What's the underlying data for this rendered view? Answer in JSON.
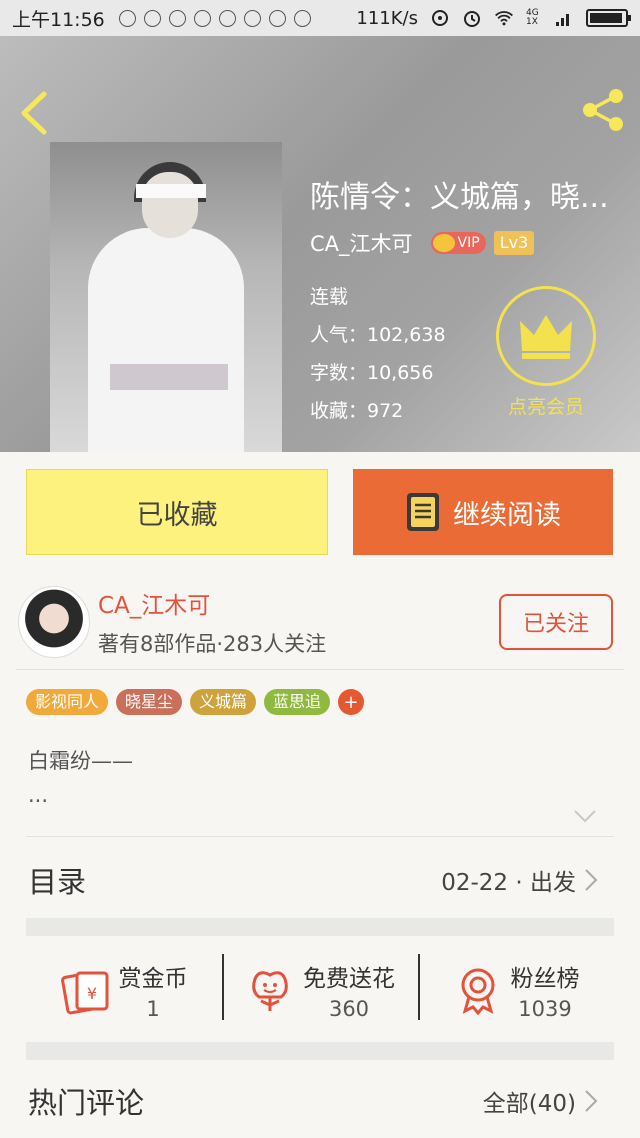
{
  "status_bar": {
    "time": "上午11:56",
    "net_speed": "111K/s",
    "network_type": "4G 1X"
  },
  "book": {
    "title": "陈情令：义城篇，晓...",
    "author": "CA_江木可",
    "vip_label": "VIP",
    "level": "Lv3",
    "status": "连载",
    "popularity": "人气：102,638",
    "word_count": "字数：10,656",
    "collections": "收藏：972"
  },
  "member": {
    "label": "点亮会员"
  },
  "actions": {
    "collected_label": "已收藏",
    "continue_label": "继续阅读"
  },
  "author_card": {
    "name": "CA_江木可",
    "meta": "著有8部作品·283人关注",
    "follow_label": "已关注"
  },
  "tags": [
    {
      "label": "影视同人",
      "color": "#f0a93a"
    },
    {
      "label": "晓星尘",
      "color": "#c96f5a"
    },
    {
      "label": "义城篇",
      "color": "#cfa33b"
    },
    {
      "label": "蓝思追",
      "color": "#8fba3f"
    }
  ],
  "summary": {
    "line1": "白霜纷——",
    "line2": "..."
  },
  "toc": {
    "title": "目录",
    "latest": "02-22 · 出发"
  },
  "rewards": [
    {
      "label": "赏金币",
      "value": "1",
      "icon": "red-envelope-icon"
    },
    {
      "label": "免费送花",
      "value": "360",
      "icon": "flower-icon"
    },
    {
      "label": "粉丝榜",
      "value": "1039",
      "icon": "medal-icon"
    }
  ],
  "comments": {
    "title": "热门评论",
    "all_label": "全部(40)"
  },
  "colors": {
    "accent_orange": "#ea6b35",
    "accent_red": "#e3523b",
    "collected_yellow": "#fcf27d",
    "member_yellow": "#f4e14e"
  }
}
